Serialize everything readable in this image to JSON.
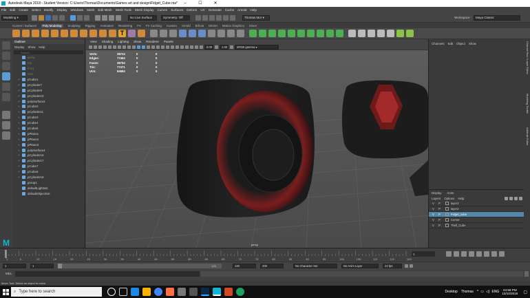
{
  "window": {
    "title": "Autodesk Maya 2018 - Student Version: C:\\Users\\Thomas\\Documents\\Games art and design\\Fidget_Cube.ma*"
  },
  "menubar": [
    "File",
    "Edit",
    "Create",
    "Select",
    "Modify",
    "Display",
    "Windows",
    "Mesh",
    "Edit Mesh",
    "Mesh Tools",
    "Mesh Display",
    "Curves",
    "Surfaces",
    "Deform",
    "UV",
    "Generate",
    "Cache",
    "Arnold",
    "Help"
  ],
  "status": {
    "mode": "Modeling",
    "live_surface": "No Live Surface",
    "symmetry": "Symmetry: Off",
    "user": "Thomas Mor",
    "workspace_label": "Workspace :",
    "workspace": "Maya Classic"
  },
  "shelf_tabs": [
    "Curves / Surfaces",
    "Poly Modeling",
    "Sculpting",
    "Rigging",
    "Animation",
    "Rendering",
    "FX",
    "FX Caching",
    "Custom",
    "Arnold",
    "Bifrost",
    "MASH",
    "Motion Graphics",
    "XGen"
  ],
  "shelf_active": "Poly Modeling",
  "outliner": {
    "title": "Outliner",
    "menu": [
      "Display",
      "Show",
      "Help"
    ],
    "search_placeholder": "Search...",
    "items": [
      "persp",
      "top",
      "front",
      "side",
      "pCube1",
      "pCylinder7",
      "pCylinder9",
      "pCylinder10",
      "polySurface2",
      "pCube2",
      "pCylinder11",
      "pCube3",
      "pCube4",
      "pCube5",
      "pPlane1",
      "pPlane2",
      "pPlane3",
      "polySurface4",
      "pCylinder16",
      "pCylinder17",
      "pCube7",
      "pCube8",
      "pCylinder18",
      "group1",
      "defaultLightSet",
      "defaultObjectSet"
    ]
  },
  "viewport": {
    "menu": [
      "View",
      "Shading",
      "Lighting",
      "Show",
      "Renderer",
      "Panels"
    ],
    "near": "0.00",
    "far": "1.00",
    "color_space": "sRGB gamma",
    "camera": "persp",
    "hud": [
      {
        "label": "Verts:",
        "v1": "38724",
        "v2": "0",
        "v3": "0"
      },
      {
        "label": "Edges:",
        "v1": "77463",
        "v2": "0",
        "v3": "0"
      },
      {
        "label": "Faces:",
        "v1": "38764",
        "v2": "0",
        "v3": "0"
      },
      {
        "label": "Tris:",
        "v1": "77471",
        "v2": "0",
        "v3": "0"
      },
      {
        "label": "UVs:",
        "v1": "84684",
        "v2": "0",
        "v3": "0"
      }
    ]
  },
  "channels": {
    "menu": [
      "Channels",
      "Edit",
      "Object",
      "Show"
    ]
  },
  "layers": {
    "tabs": [
      "Display",
      "Anim"
    ],
    "menu": [
      "Layers",
      "Options",
      "Help"
    ],
    "rows": [
      {
        "v": "V",
        "p": "P",
        "name": "layer3"
      },
      {
        "v": "V",
        "p": "P",
        "name": "layer2"
      },
      {
        "v": "V",
        "p": "P",
        "name": "Fidget_cube"
      },
      {
        "v": "V",
        "p": "P",
        "name": "Corner"
      },
      {
        "v": "V",
        "p": "P",
        "name": "Thell_Cube"
      }
    ],
    "selected": "Fidget_cube"
  },
  "side_tabs": [
    "Channel Box / Layer Editor",
    "Modeling Toolkit",
    "Attribute Editor"
  ],
  "timeline": {
    "ticks": [
      "1",
      "5",
      "10",
      "15",
      "20",
      "25",
      "30",
      "35",
      "40",
      "45",
      "50",
      "55",
      "60",
      "65",
      "70",
      "75",
      "80",
      "85",
      "90",
      "95",
      "100",
      "105",
      "110",
      "115",
      "120"
    ],
    "current": "1"
  },
  "range": {
    "start": "1",
    "range_start": "1",
    "range_label": "120",
    "range_end": "120",
    "end": "200",
    "character_set": "No Character Set",
    "anim_layer": "No Anim Layer",
    "fps": "24 fps"
  },
  "cmd": {
    "label": "MEL"
  },
  "help_line": "Move Tool: Select an object to move.",
  "taskbar": {
    "search": "Type here to search",
    "desktop": "Desktop",
    "user": "Thomas",
    "lang": "ENG",
    "time": "04:59 PM",
    "date": "13/10/2019"
  }
}
